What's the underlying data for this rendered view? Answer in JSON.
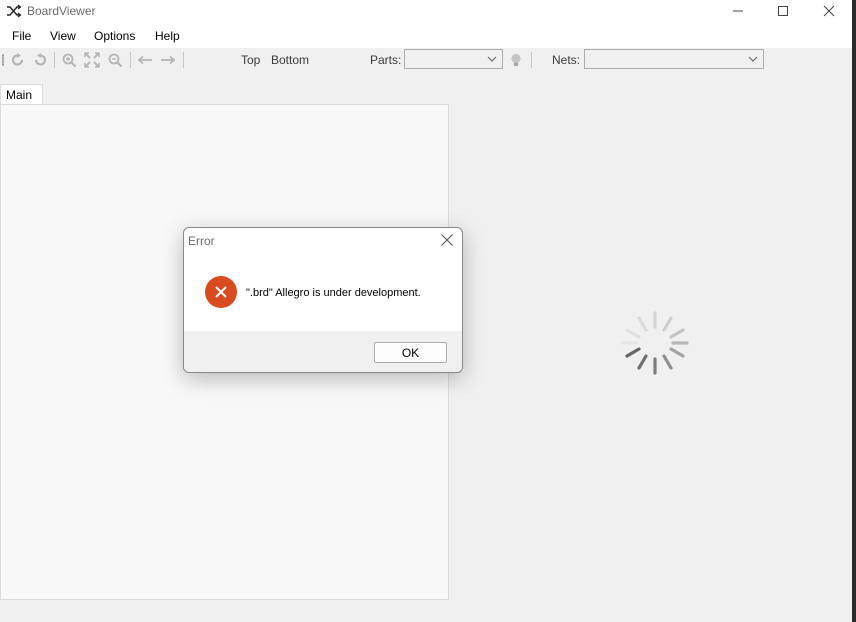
{
  "window": {
    "title": "BoardViewer",
    "icon": "shuffle-icon"
  },
  "menu": {
    "items": [
      "File",
      "View",
      "Options",
      "Help"
    ]
  },
  "toolbar": {
    "icons": [
      "rotate-cw-icon",
      "rotate-ccw-icon",
      "zoom-in-icon",
      "zoom-fit-icon",
      "zoom-out-icon",
      "arrow-left-icon",
      "arrow-right-icon"
    ],
    "top_label": "Top",
    "bottom_label": "Bottom",
    "parts_label": "Parts:",
    "parts_value": "",
    "nets_label": "Nets:",
    "nets_value": ""
  },
  "tabs": {
    "main_label": "Main"
  },
  "dialog": {
    "title": "Error",
    "message": "\".brd\" Allegro is under development.",
    "ok_label": "OK",
    "icon": "error-icon",
    "icon_color": "#d94a1e"
  }
}
